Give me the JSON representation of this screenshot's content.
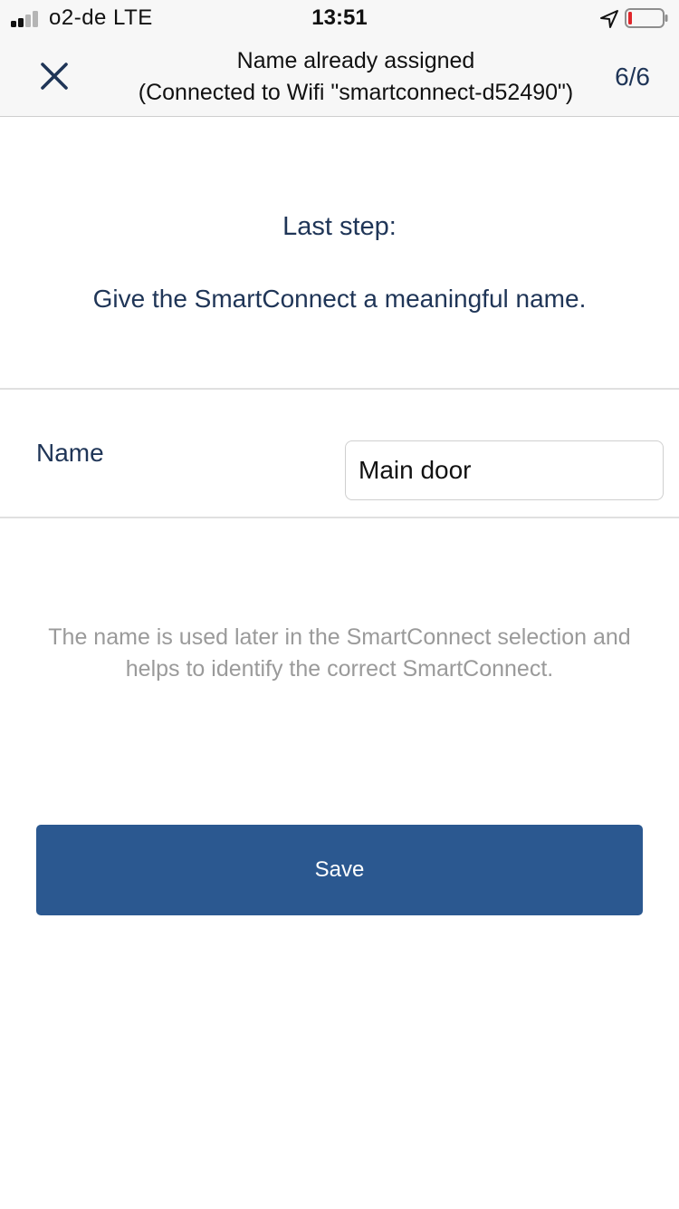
{
  "status_bar": {
    "carrier": "o2-de  LTE",
    "time": "13:51",
    "signal_bars_active": 2,
    "signal_bars_total": 4,
    "battery_level": 0.08,
    "battery_color": "#e0262b",
    "icons": [
      "signal-icon",
      "location-arrow-icon",
      "battery-icon"
    ]
  },
  "nav_bar": {
    "title_line1": "Name already assigned",
    "title_line2": "(Connected to Wifi \"smartconnect-d52490\")",
    "step": "6/6",
    "close_icon": "close-icon"
  },
  "intro": {
    "heading": "Last step:",
    "text": "Give the SmartConnect a meaningful name."
  },
  "form": {
    "name_label": "Name",
    "name_value": "Main door"
  },
  "hint": {
    "line1": "The name is used later in the SmartConnect selection and",
    "line2": "helps to identify the correct SmartConnect."
  },
  "actions": {
    "save_label": "Save"
  },
  "colors": {
    "accent": "#2b5890",
    "text_primary": "#1f3557",
    "hint": "#9a9a9a",
    "nav_background": "#f7f7f7"
  }
}
